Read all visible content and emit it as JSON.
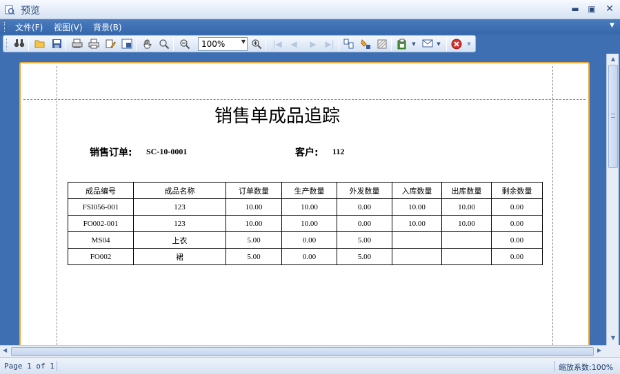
{
  "window": {
    "title": "预览"
  },
  "menu": {
    "items": [
      "文件(F)",
      "视图(V)",
      "背景(B)"
    ]
  },
  "toolbar": {
    "icons": [
      "find-icon",
      "open-icon",
      "save-icon",
      "page-setup-icon",
      "print-icon",
      "print-edit-icon",
      "scale-icon",
      "hand-icon",
      "magnifier-icon",
      "zoom-out-icon",
      "zoom-in-icon",
      "first-page-icon",
      "prev-page-icon",
      "next-page-icon",
      "last-page-icon",
      "multipage-icon",
      "color-icon",
      "watermark-icon",
      "export-icon",
      "email-icon",
      "close-preview-icon"
    ],
    "zoom_value": "100%"
  },
  "report": {
    "title": "销售单成品追踪",
    "order_label": "销售订单:",
    "order_value": "SC-10-0001",
    "customer_label": "客户:",
    "customer_value": "112",
    "columns": [
      "成品编号",
      "成品名称",
      "订单数量",
      "生产数量",
      "外发数量",
      "入库数量",
      "出库数量",
      "剩余数量"
    ],
    "rows": [
      [
        "FSI056-001",
        "123",
        "10.00",
        "10.00",
        "0.00",
        "10.00",
        "10.00",
        "0.00"
      ],
      [
        "FO002-001",
        "123",
        "10.00",
        "10.00",
        "0.00",
        "10.00",
        "10.00",
        "0.00"
      ],
      [
        "MS04",
        "上衣",
        "5.00",
        "0.00",
        "5.00",
        "",
        "",
        "0.00"
      ],
      [
        "FO002",
        "裙",
        "5.00",
        "0.00",
        "5.00",
        "",
        "",
        "0.00"
      ]
    ]
  },
  "status": {
    "page_info": "Page 1 of 1",
    "zoom_info": "缩放系数:100%"
  },
  "colors": {
    "accent": "#3d6fb2",
    "page_border": "#f0a938",
    "close_red": "#d9302c"
  }
}
